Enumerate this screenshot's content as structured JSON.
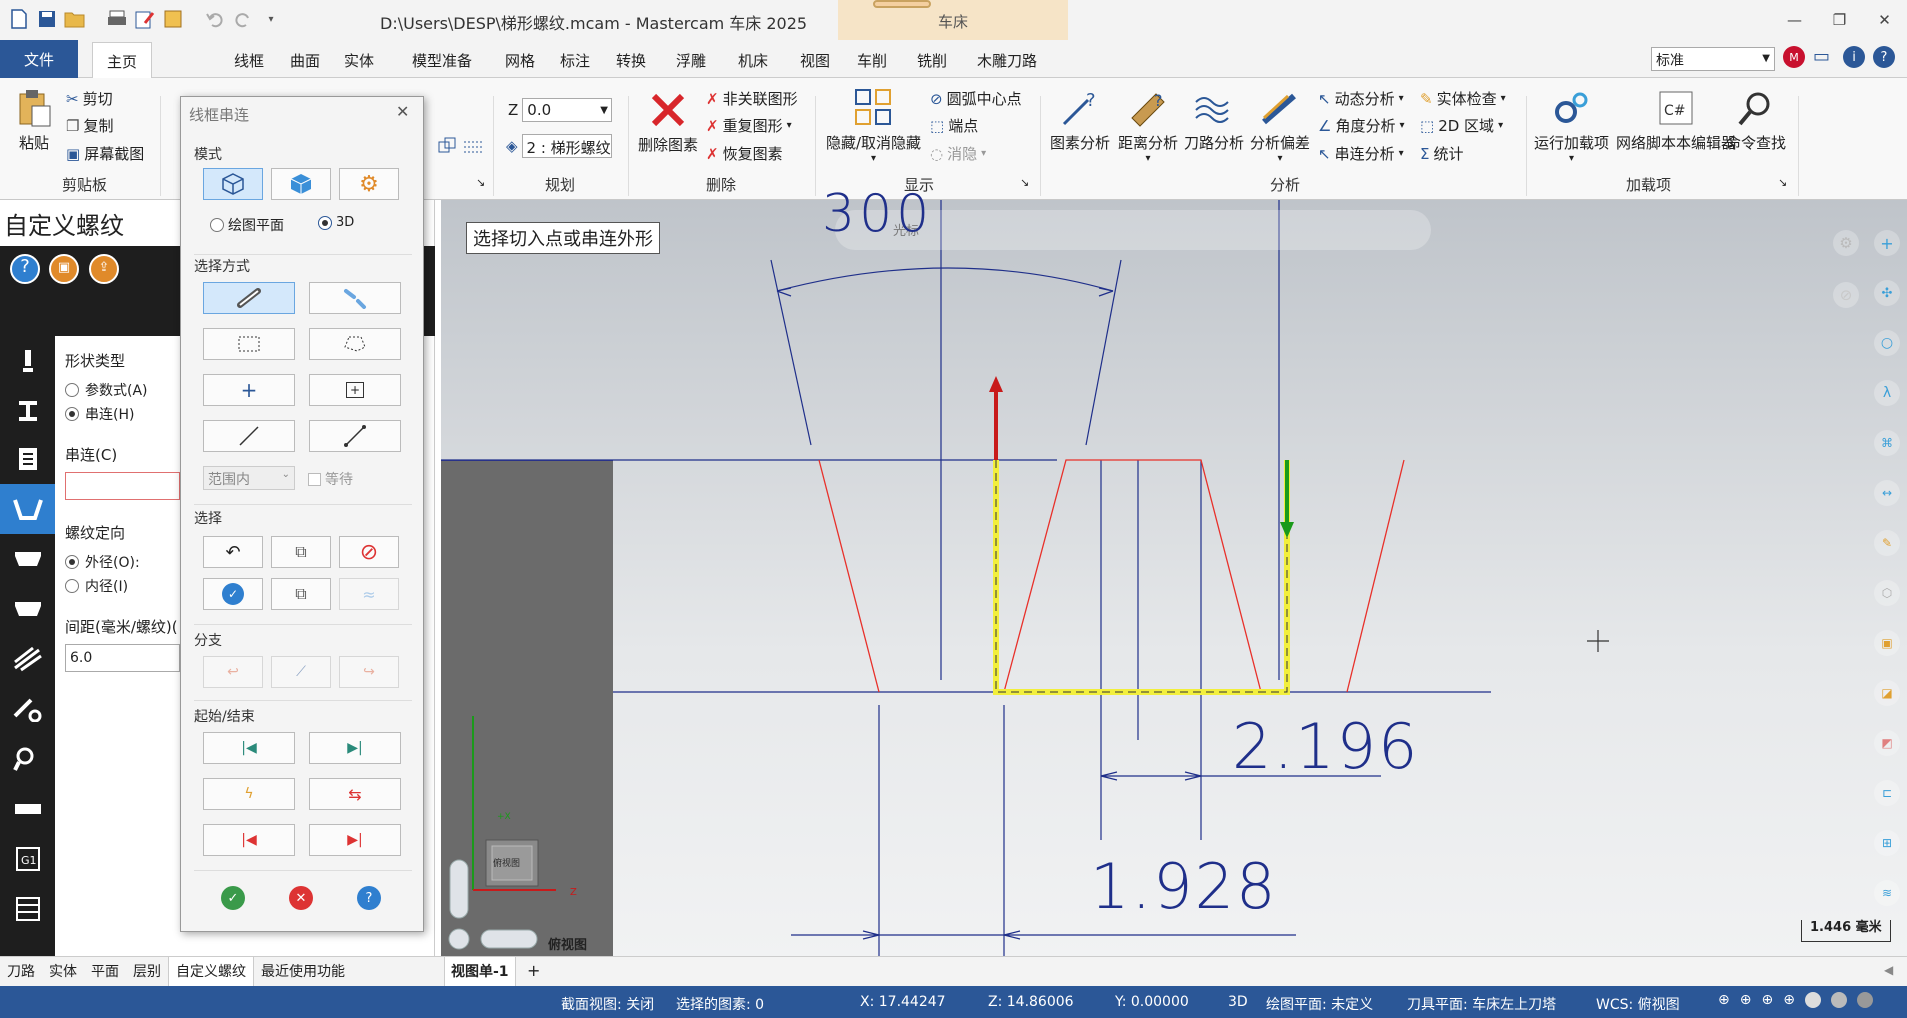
{
  "app": {
    "title": "D:\\Users\\DESP\\梯形螺纹.mcam - Mastercam 车床 2025",
    "context_tab": "车床",
    "file_tab": "文件",
    "tabs": [
      "主页",
      "线框",
      "曲面",
      "实体",
      "模型准备",
      "网格",
      "标注",
      "转换",
      "浮雕",
      "机床",
      "视图",
      "车削",
      "铣削",
      "木雕刀路"
    ],
    "active_tab": "主页",
    "view_selector": "标准"
  },
  "ribbon": {
    "clipboard": {
      "label": "剪贴板",
      "paste": "粘贴",
      "cut": "剪切",
      "copy": "复制",
      "screenshot": "屏幕截图"
    },
    "planning": {
      "label": "规划",
      "z_label": "Z",
      "z_value": "0.0",
      "level_value": "2 : 梯形螺纹"
    },
    "delete": {
      "label": "删除",
      "delete_entities": "删除图素",
      "non_assoc": "非关联图形",
      "dup_entities": "重复图形",
      "restore": "恢复图素"
    },
    "display": {
      "label": "显示",
      "hide_unhide": "隐藏/取消隐藏",
      "arc_center": "圆弧中心点",
      "endpoints": "端点",
      "blank": "消隐"
    },
    "analyze": {
      "label": "分析",
      "entity": "图素分析",
      "distance": "距离分析",
      "toolpath": "刀路分析",
      "deviation": "分析偏差",
      "dynamic": "动态分析",
      "angle": "角度分析",
      "chain": "串连分析",
      "solid_check": "实体检查",
      "area_2d": "2D 区域",
      "stats": "统计"
    },
    "addins": {
      "label": "加载项",
      "run_addin": "运行加载项",
      "script_editor": "网络脚本本编辑器",
      "cmd_find": "命令查找"
    }
  },
  "left_panel": {
    "title": "自定义螺纹",
    "shape_type_label": "形状类型",
    "shape_param": "参数式(A)",
    "shape_chain": "串连(H)",
    "chain_label": "串连(C)",
    "thread_orient_label": "螺纹定向",
    "orient_od": "外径(O):",
    "orient_id": "内径(I)",
    "pitch_label": "间距(毫米/螺纹)(",
    "pitch_value": "6.0"
  },
  "dialog": {
    "title": "线框串连",
    "mode_label": "模式",
    "radio_plane": "绘图平面",
    "radio_3d": "3D",
    "method_label": "选择方式",
    "range_select": "范围内",
    "wait_label": "等待",
    "select_label": "选择",
    "branch_label": "分支",
    "startend_label": "起始/结束"
  },
  "viewport": {
    "prompt": "选择切入点或串连外形",
    "dim_top": "300",
    "dim_mid": "2.196",
    "dim_bot": "1.928",
    "view_label": "俯视图",
    "cube_label": "俯视图",
    "axis_x": "+X",
    "axis_z": "Z",
    "scale": "1.446 毫米",
    "toolbar_text": "光标"
  },
  "bottom_tabs": [
    "刀路",
    "实体",
    "平面",
    "层别",
    "自定义螺纹",
    "最近使用功能"
  ],
  "active_bottom_tab": "自定义螺纹",
  "viewport_tab": "视图单-1",
  "status": {
    "section_view": "截面视图: 关闭",
    "selected": "选择的图素: 0",
    "x": "X:  17.44247",
    "z": "Z:  14.86006",
    "y": "Y:  0.00000",
    "mode": "3D",
    "cplane": "绘图平面: 未定义",
    "tplane": "刀具平面: 车床左上刀塔",
    "wcs": "WCS: 俯视图"
  },
  "colors": {
    "accent": "#2b5797",
    "chain_red": "#e8302a",
    "chain_yellow": "#f2ef3c",
    "wire": "#1f2f8a"
  }
}
